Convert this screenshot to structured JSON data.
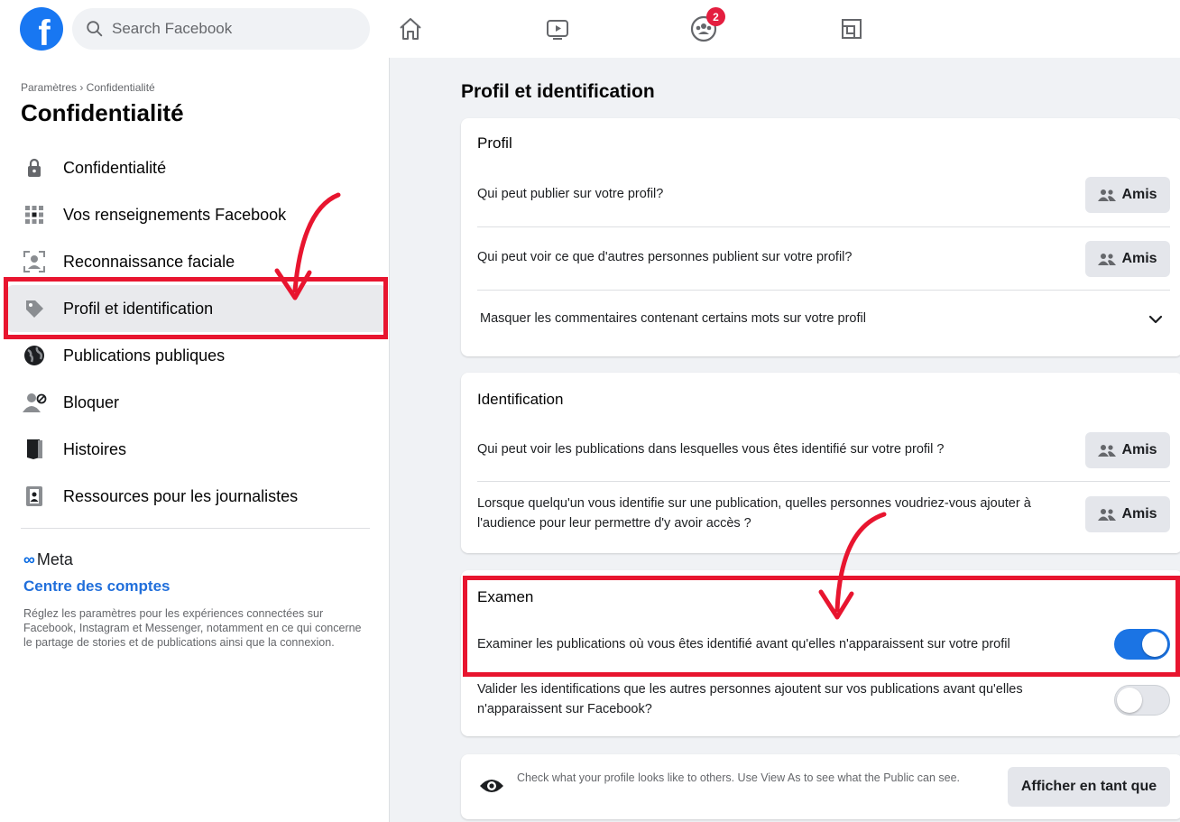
{
  "topbar": {
    "search_placeholder": "Search Facebook",
    "notifications_badge": "2"
  },
  "sidebar": {
    "breadcrumb": "Paramètres › Confidentialité",
    "title": "Confidentialité",
    "items": [
      {
        "label": "Confidentialité",
        "icon": "lock-icon"
      },
      {
        "label": "Vos renseignements Facebook",
        "icon": "grid-icon"
      },
      {
        "label": "Reconnaissance faciale",
        "icon": "face-scan-icon"
      },
      {
        "label": "Profil et identification",
        "icon": "tag-icon",
        "active": true
      },
      {
        "label": "Publications publiques",
        "icon": "globe-icon"
      },
      {
        "label": "Bloquer",
        "icon": "user-block-icon"
      },
      {
        "label": "Histoires",
        "icon": "book-icon"
      },
      {
        "label": "Ressources pour les journalistes",
        "icon": "id-badge-icon"
      }
    ],
    "meta_logo": "Meta",
    "accounts_link": "Centre des comptes",
    "accounts_desc": "Réglez les paramètres pour les expériences connectées sur Facebook, Instagram et Messenger, notamment en ce qui concerne le partage de stories et de publications ainsi que la connexion."
  },
  "main": {
    "title": "Profil et identification",
    "profil": {
      "heading": "Profil",
      "q1": "Qui peut publier sur votre profil?",
      "q1_value": "Amis",
      "q2": "Qui peut voir ce que d'autres personnes publient sur votre profil?",
      "q2_value": "Amis",
      "q3": "Masquer les commentaires contenant certains mots sur votre profil"
    },
    "identification": {
      "heading": "Identification",
      "q1": "Qui peut voir les publications dans lesquelles vous êtes identifié sur votre profil ?",
      "q1_value": "Amis",
      "q2": "Lorsque quelqu'un vous identifie sur une publication, quelles personnes voudriez-vous ajouter à l'audience pour leur permettre d'y avoir accès ?",
      "q2_value": "Amis"
    },
    "examen": {
      "heading": "Examen",
      "q1": "Examiner les publications où vous êtes identifié avant qu'elles n'apparaissent sur votre profil",
      "q1_on": true,
      "q2": "Valider les identifications que les autres personnes ajoutent sur vos publications avant qu'elles n'apparaissent sur Facebook?",
      "q2_on": false
    },
    "view_as": {
      "text": "Check what your profile looks like to others. Use View As to see what the Public can see.",
      "button": "Afficher en tant que"
    }
  },
  "colors": {
    "brand": "#1877f2",
    "annotation_red": "#e8152f",
    "toggle_on": "#1b74e4"
  }
}
